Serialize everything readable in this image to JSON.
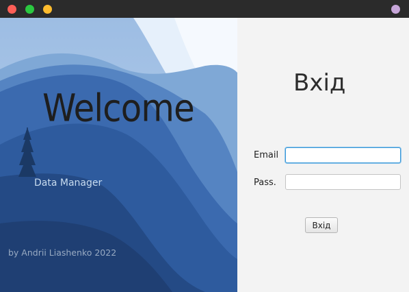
{
  "window": {
    "buttons": [
      "close",
      "minimize",
      "maximize"
    ],
    "colors": {
      "titlebar": "#2b2b2b",
      "close": "#ff5f57",
      "minimize": "#2bc840",
      "maximize": "#febc2e",
      "user_dot": "#c7a6d9"
    }
  },
  "left_panel": {
    "welcome": "Welcome",
    "app_name": "Data Manager",
    "author": "by Andrii Liashenko 2022",
    "background": "blue-mountains-landscape"
  },
  "form": {
    "title": "Вхід",
    "email_label": "Email",
    "email_value": "",
    "pass_label": "Pass.",
    "pass_value": "",
    "login_button": "Вхід",
    "focus_color": "#3b99d8"
  }
}
